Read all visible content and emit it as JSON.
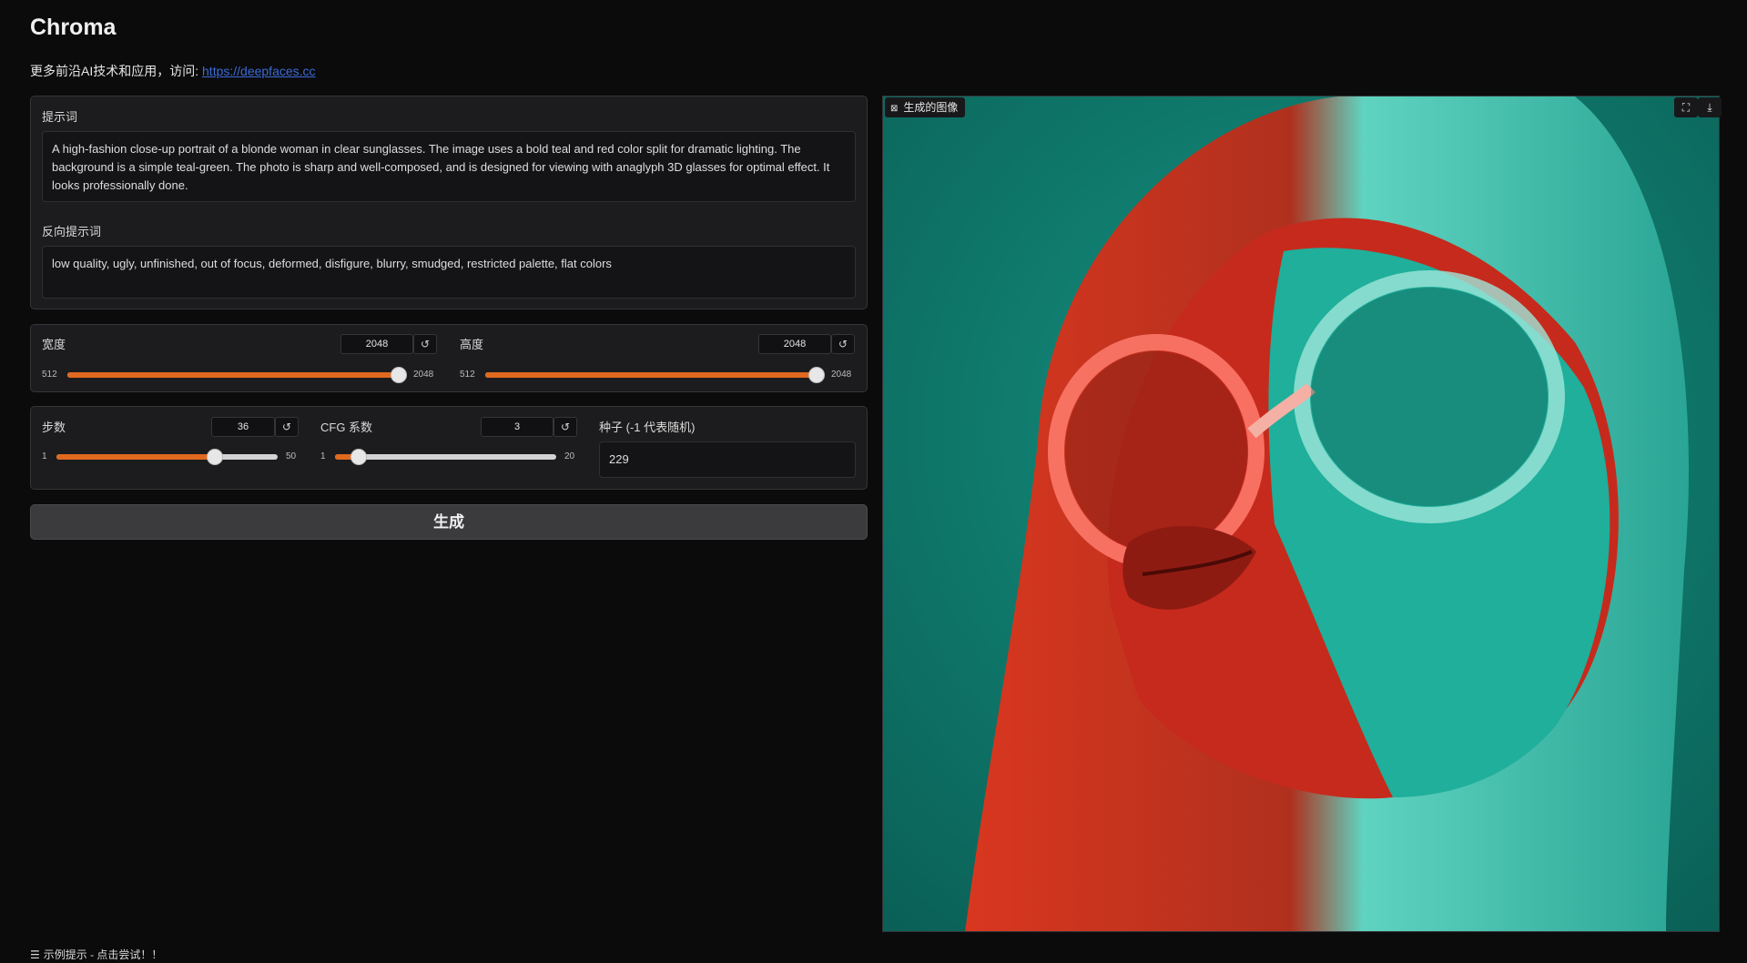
{
  "app": {
    "title": "Chroma",
    "subtitle_text": "更多前沿AI技术和应用，访问: ",
    "subtitle_link": "https://deepfaces.cc"
  },
  "prompt": {
    "label": "提示词",
    "value": "A high-fashion close-up portrait of a blonde woman in clear sunglasses. The image uses a bold teal and red color split for dramatic lighting. The background is a simple teal-green. The photo is sharp and well-composed, and is designed for viewing with anaglyph 3D glasses for optimal effect. It looks professionally done."
  },
  "negative_prompt": {
    "label": "反向提示词",
    "value": "low quality, ugly, unfinished, out of focus, deformed, disfigure, blurry, smudged, restricted palette, flat colors"
  },
  "width": {
    "label": "宽度",
    "value": "2048",
    "min": "512",
    "max": "2048",
    "fraction": 1.0
  },
  "height": {
    "label": "高度",
    "value": "2048",
    "min": "512",
    "max": "2048",
    "fraction": 1.0
  },
  "steps": {
    "label": "步数",
    "value": "36",
    "min": "1",
    "max": "50",
    "fraction": 0.714
  },
  "cfg": {
    "label": "CFG 系数",
    "value": "3",
    "min": "1",
    "max": "20",
    "fraction": 0.105
  },
  "seed": {
    "label": "种子 (-1 代表随机)",
    "value": "229"
  },
  "reset_icon": "↺",
  "generate_button": "生成",
  "output": {
    "label": "生成的图像",
    "label_icon": "image-icon",
    "fullscreen_icon": "fullscreen-icon",
    "download_icon": "download-icon"
  },
  "examples": {
    "label": "示例提示 - 点击尝试！！",
    "icon": "list-icon"
  },
  "colors": {
    "accent": "#e0691e",
    "background": "#0b0b0c",
    "panel": "#1c1c1e",
    "teal": "#0f7a6b",
    "red": "#d8261c"
  }
}
